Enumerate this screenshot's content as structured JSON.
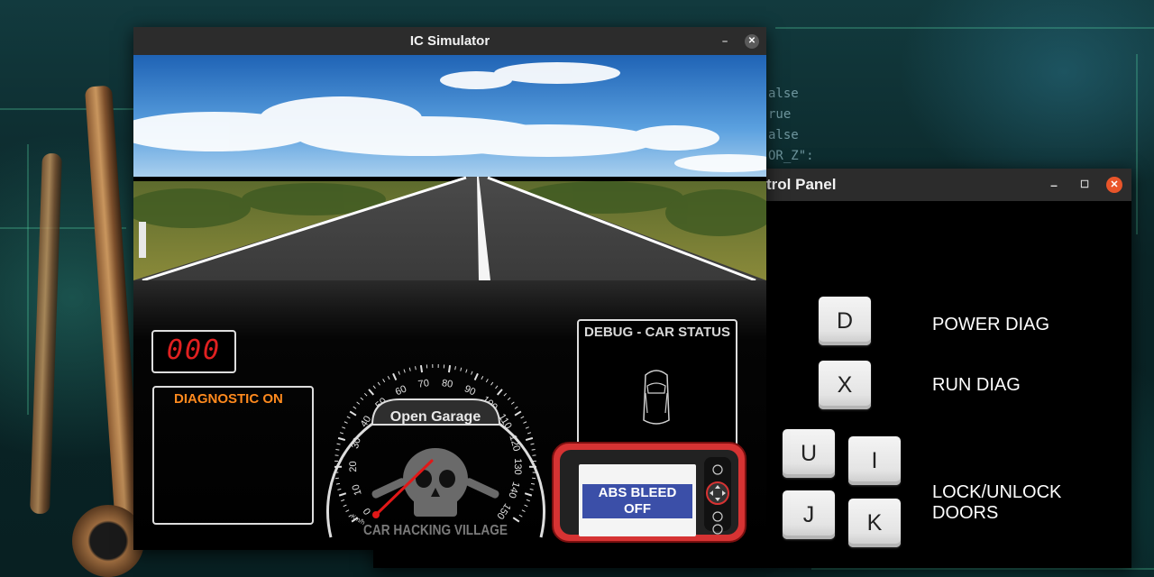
{
  "ic_simulator": {
    "title": "IC Simulator",
    "controls": {
      "minimize": "–",
      "close": "✕"
    },
    "odometer": "000",
    "diagnostic_label": "DIAGNOSTIC ON",
    "speedometer": {
      "logo_text": "Open Garage",
      "unit": "Km/h",
      "ticks": [
        "0",
        "10",
        "20",
        "30",
        "40",
        "50",
        "60",
        "70",
        "80",
        "90",
        "100",
        "110",
        "120",
        "130",
        "140",
        "150"
      ],
      "needle_speed": 0,
      "watermark": "CAR HACKING VILLAGE"
    },
    "debug_panel": {
      "title": "DEBUG - CAR STATUS",
      "icon": "car-top-view-icon"
    },
    "scanner": {
      "screen_text": [
        "ABS BLEED",
        "OFF"
      ]
    }
  },
  "control_panel": {
    "title": "trol Panel",
    "controls": {
      "minimize": "–",
      "maximize": "☐",
      "close": "✕"
    },
    "keys": {
      "d": "D",
      "x": "X",
      "u": "U",
      "i": "I",
      "j": "J",
      "k": "K"
    },
    "labels": {
      "power_diag": "POWER DIAG",
      "run_diag": "RUN DIAG",
      "lock_unlock": "LOCK/UNLOCK DOORS"
    }
  },
  "desktop": {
    "code_fragments": [
      "alse",
      "rue",
      "alse",
      "OR_Z\":"
    ]
  },
  "colors": {
    "odometer_digits": "#e02020",
    "diagnostic_text": "#ff8a1e",
    "abs_label_bg": "#3b4fa8",
    "scanner_body": "#d63333",
    "close_button": "#e9552a"
  }
}
